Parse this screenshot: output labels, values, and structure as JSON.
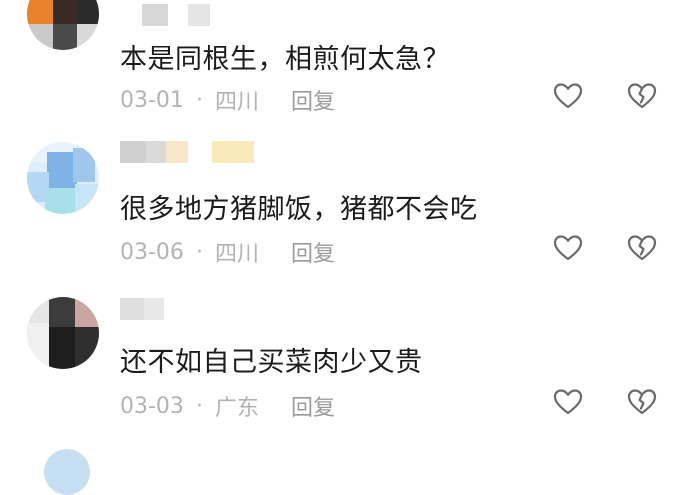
{
  "comments": [
    {
      "text": "本是同根生，相煎何太急？",
      "date": "03-01",
      "separator": "·",
      "location": "四川",
      "reply_label": "回复",
      "like_icon": "heart-outline-icon",
      "dislike_icon": "broken-heart-icon"
    },
    {
      "text": "很多地方猪脚饭，猪都不会吃",
      "date": "03-06",
      "separator": "·",
      "location": "四川",
      "reply_label": "回复",
      "like_icon": "heart-outline-icon",
      "dislike_icon": "broken-heart-icon"
    },
    {
      "text": "还不如自己买菜肉少又贵",
      "date": "03-03",
      "separator": "·",
      "location": "广东",
      "reply_label": "回复",
      "like_icon": "heart-outline-icon",
      "dislike_icon": "broken-heart-icon"
    }
  ],
  "colors": {
    "text": "#1c1c1c",
    "meta": "#b3b3b3",
    "reply": "#9b9b9b",
    "icon_stroke": "#6a6a6a"
  }
}
